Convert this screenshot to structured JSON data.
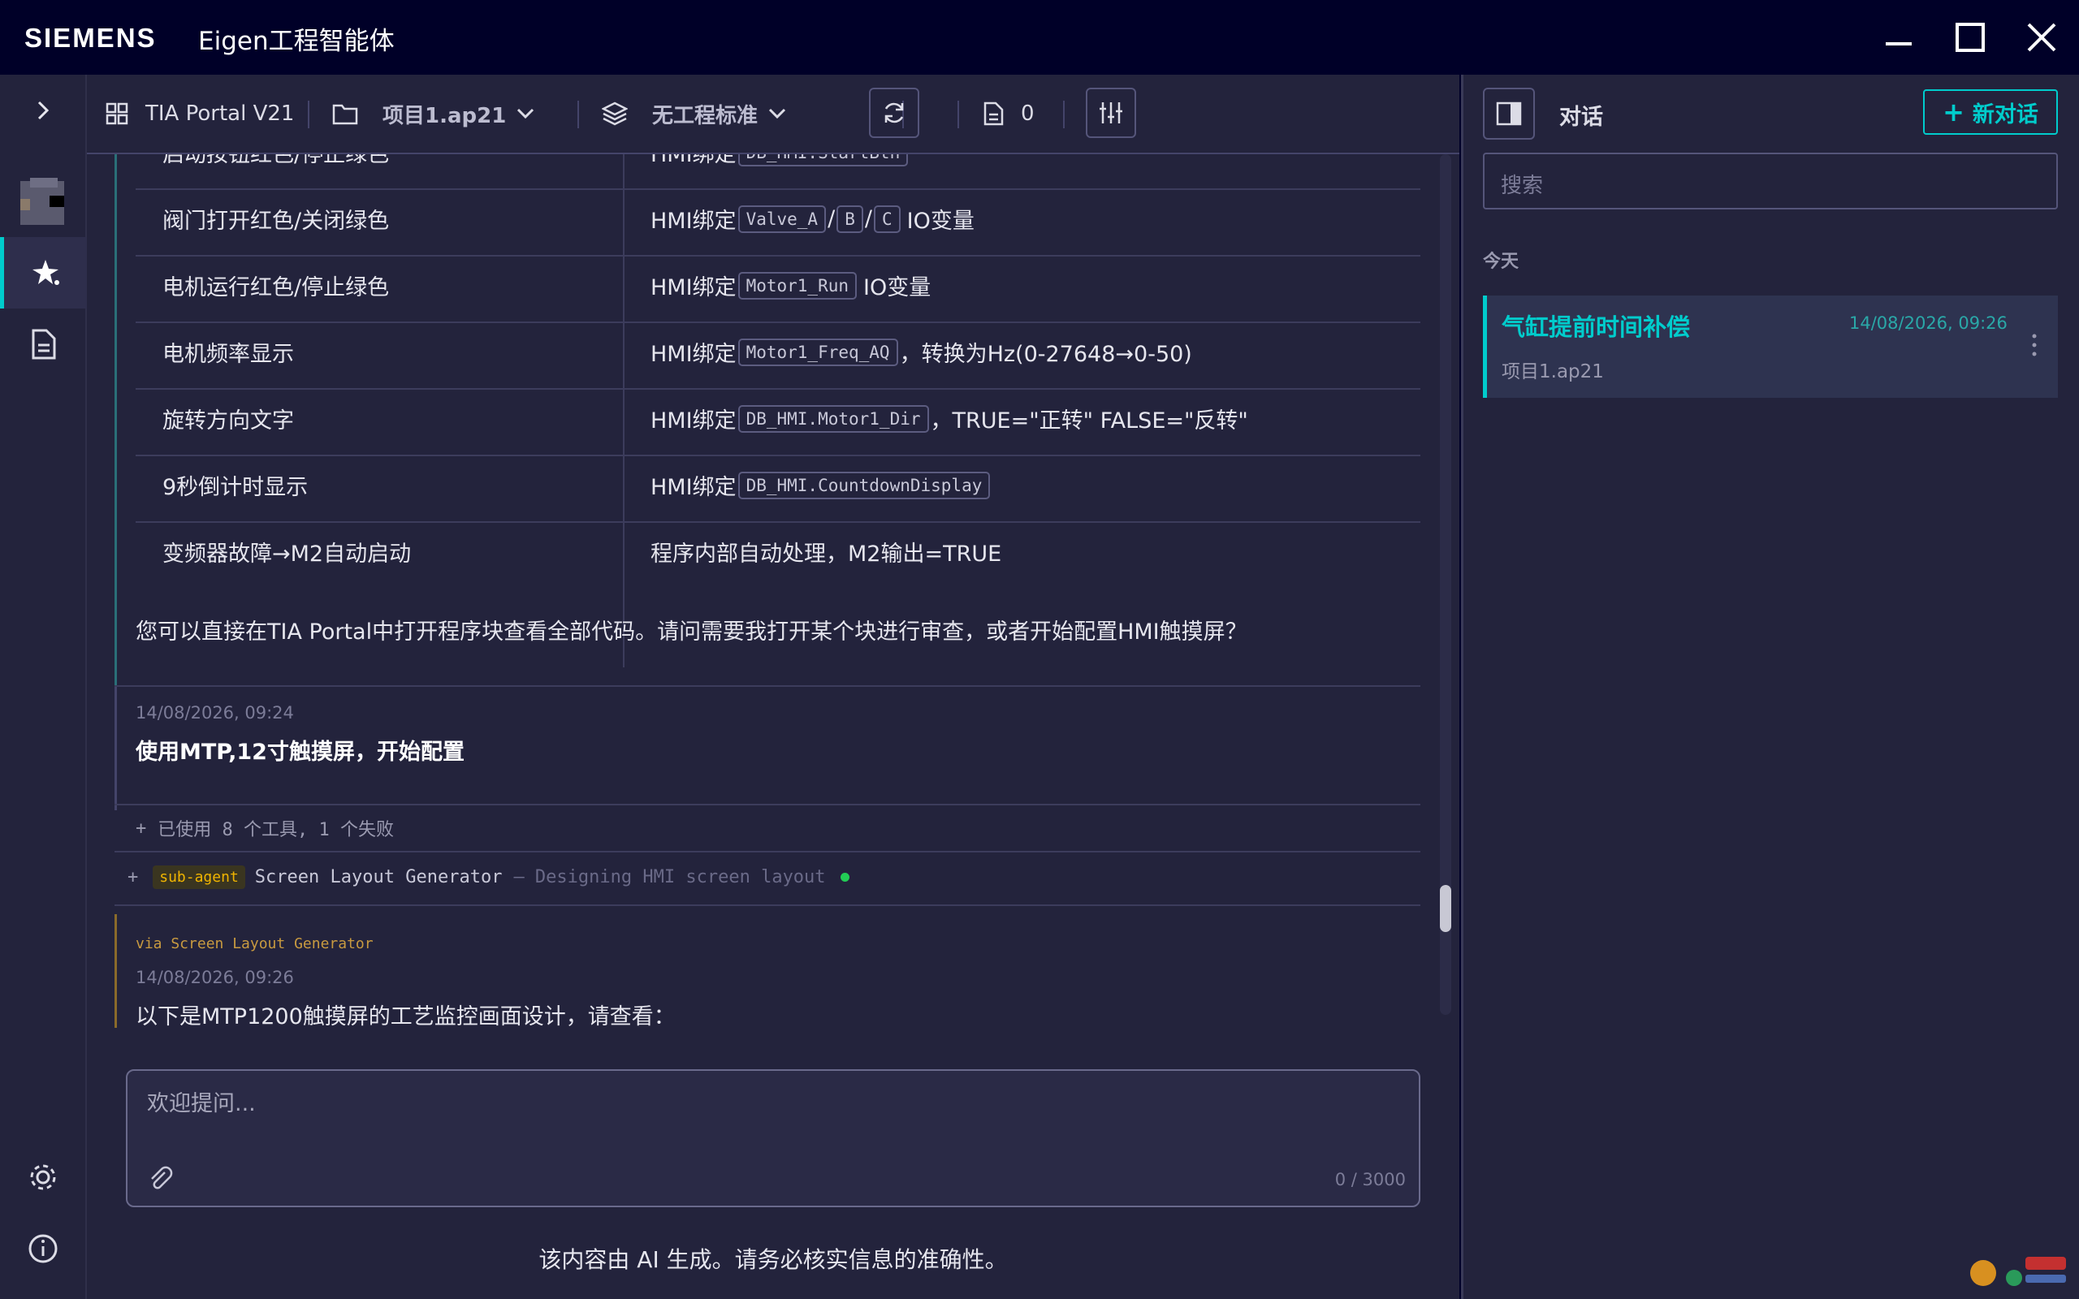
{
  "window": {
    "brand": "SIEMENS",
    "title": "Eigen工程智能体"
  },
  "toolbar": {
    "portal": "TIA Portal V21",
    "project": "项目1.ap21",
    "standard": "无工程标准",
    "doc_count": "0"
  },
  "table": {
    "partial_left": "启动按钮红色/停止绿色",
    "partial_right_prefix": "HMI绑定",
    "partial_right_code": "DB_HMI.StartBtn",
    "rows": [
      {
        "feature": "阀门打开红色/关闭绿色",
        "prefix": "HMI绑定",
        "codes": [
          "Valve_A",
          "B",
          "C"
        ],
        "seps": [
          "/",
          "/"
        ],
        "suffix": "IO变量"
      },
      {
        "feature": "电机运行红色/停止绿色",
        "prefix": "HMI绑定",
        "code": "Motor1_Run",
        "suffix": "IO变量"
      },
      {
        "feature": "电机频率显示",
        "prefix": "HMI绑定",
        "code": "Motor1_Freq_AQ",
        "suffix": "，转换为Hz(0-27648→0-50)"
      },
      {
        "feature": "旋转方向文字",
        "prefix": "HMI绑定",
        "code": "DB_HMI.Motor1_Dir",
        "suffix": "，TRUE=\"正转\" FALSE=\"反转\""
      },
      {
        "feature": "9秒倒计时显示",
        "prefix": "HMI绑定",
        "code": "DB_HMI.CountdownDisplay",
        "suffix": ""
      },
      {
        "feature": "变频器故障→M2自动启动",
        "text": "程序内部自动处理，M2输出=TRUE"
      }
    ]
  },
  "messages": {
    "assistant_tail": "您可以直接在TIA Portal中打开程序块查看全部代码。请问需要我打开某个块进行审查，或者开始配置HMI触摸屏？",
    "user_time": "14/08/2026, 09:24",
    "user_text": "使用MTP,12寸触摸屏，开始配置",
    "tools_plus": "+",
    "tools_text": "已使用 8 个工具, 1 个失败",
    "subagent_plus": "+",
    "subagent_badge": "sub-agent",
    "subagent_name": "Screen Layout Generator",
    "subagent_status": "— Designing HMI screen layout",
    "via": "via Screen Layout Generator",
    "reply_time": "14/08/2026, 09:26",
    "reply_text": "以下是MTP1200触摸屏的工艺监控画面设计，请查看："
  },
  "input": {
    "placeholder": "欢迎提问...",
    "counter": "0 / 3000"
  },
  "disclaimer": "该内容由 AI 生成。请务必核实信息的准确性。",
  "sidebar": {
    "title": "对话",
    "new_button": "新对话",
    "new_plus": "+",
    "search_placeholder": "搜索",
    "section_today": "今天",
    "conversations": [
      {
        "title": "气缸提前时间补偿",
        "time": "14/08/2026, 09:26",
        "project": "项目1.ap21"
      }
    ]
  },
  "colors": {
    "accent": "#00cccc",
    "background": "#23233c",
    "badge": "#f0b400",
    "status_dot": "#22cc55"
  }
}
